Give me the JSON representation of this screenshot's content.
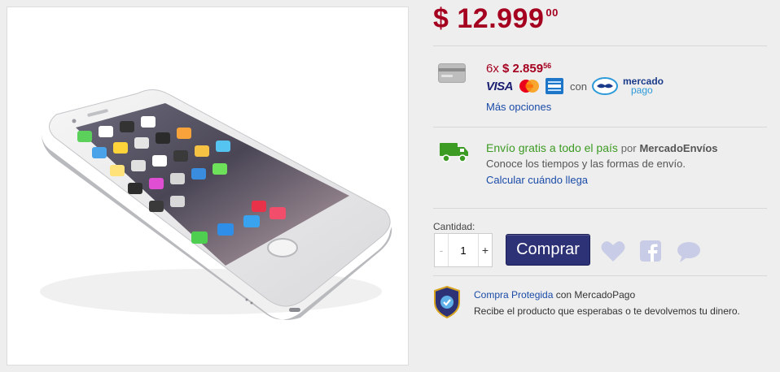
{
  "price": {
    "currency": "$",
    "whole": "12.999",
    "cents": "00"
  },
  "payment": {
    "count": "6x",
    "amount": "$ 2.859",
    "cents": "56",
    "card_brands": [
      "VISA",
      "MasterCard",
      "American Express"
    ],
    "with_label": "con",
    "mp_line1": "mercado",
    "mp_line2": "pago",
    "more_options": "Más opciones"
  },
  "shipping": {
    "free_text": "Envío gratis a todo el país",
    "by_label": "por",
    "provider": "MercadoEnvíos",
    "subtitle": "Conoce los tiempos y las formas de envío.",
    "calc_link": "Calcular cuándo llega"
  },
  "purchase": {
    "qty_label": "Cantidad:",
    "qty_value": "1",
    "minus": "-",
    "plus": "+",
    "buy_label": "Comprar"
  },
  "protection": {
    "link": "Compra Protegida",
    "suffix": "con MercadoPago",
    "desc": "Recibe el producto que esperabas o te devolvemos tu dinero."
  },
  "colors": {
    "price": "#a5001f",
    "buy_button": "#2d3277",
    "link": "#1a4ba8",
    "shipping_green": "#3c9b23",
    "action_icons": "#c9cce6"
  },
  "icons": [
    "credit-card-icon",
    "visa-logo",
    "mastercard-logo",
    "amex-logo",
    "mercadopago-logo",
    "truck-icon",
    "heart-icon",
    "facebook-icon",
    "chat-bubble-icon",
    "shield-check-icon"
  ]
}
